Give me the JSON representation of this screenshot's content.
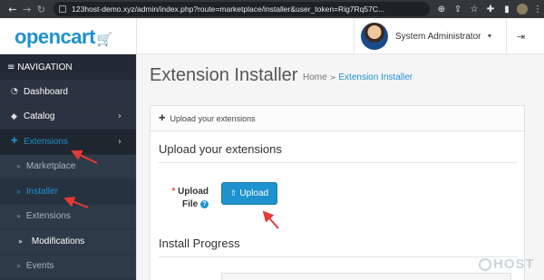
{
  "browser": {
    "url": "123host-demo.xyz/admin/index.php?route=marketplace/installer&user_token=Rig7Rq57C..."
  },
  "header": {
    "logo_text": "opencart",
    "user_name": "System Administrator"
  },
  "sidebar": {
    "title": "NAVIGATION",
    "items": [
      {
        "label": "Dashboard",
        "icon": "dashboard-icon"
      },
      {
        "label": "Catalog",
        "icon": "tag-icon"
      },
      {
        "label": "Extensions",
        "icon": "puzzle-icon"
      }
    ],
    "sub_items": [
      {
        "label": "Marketplace"
      },
      {
        "label": "Installer"
      },
      {
        "label": "Extensions"
      },
      {
        "label": "Modifications"
      },
      {
        "label": "Events"
      }
    ]
  },
  "main": {
    "title": "Extension Installer",
    "breadcrumb": [
      "Home",
      "Extension Installer"
    ],
    "panel_title": "Upload your extensions",
    "section_upload": "Upload your extensions",
    "field_label_1": "Upload",
    "field_label_2": "File",
    "required_mark": "*",
    "help_mark": "?",
    "upload_button": "Upload",
    "section_progress": "Install Progress"
  },
  "watermark": "HOST",
  "colors": {
    "accent": "#1e91cf",
    "sidebar_bg": "#2a3440",
    "annotation_red": "#e53935"
  }
}
